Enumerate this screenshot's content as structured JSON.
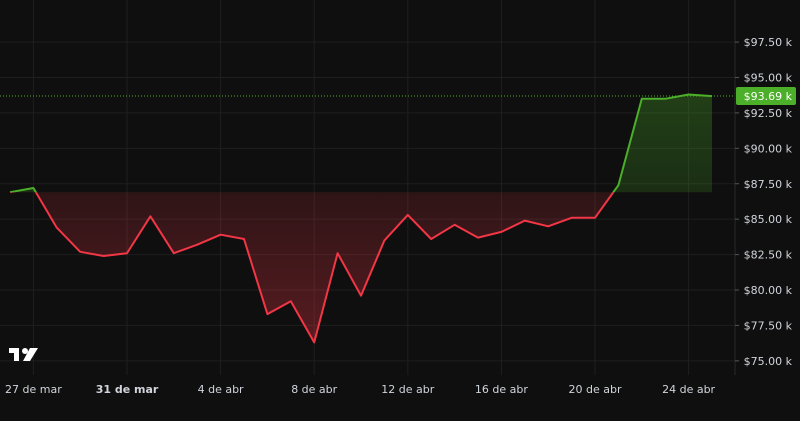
{
  "chart_data": {
    "type": "area",
    "colors": {
      "background": "#0f0f0f",
      "grid": "#1f1f1f",
      "rising": "#4caf2a",
      "falling": "#f23645",
      "price_badge": "#4caf2a",
      "text": "#d1d4dc"
    },
    "baseline": 86.9,
    "ylim": [
      74.0,
      99.2
    ],
    "y_ticks": [
      {
        "value": 75.0,
        "label": "$75.00 k"
      },
      {
        "value": 77.5,
        "label": "$77.50 k"
      },
      {
        "value": 80.0,
        "label": "$80.00 k"
      },
      {
        "value": 82.5,
        "label": "$82.50 k"
      },
      {
        "value": 85.0,
        "label": "$85.00 k"
      },
      {
        "value": 87.5,
        "label": "$87.50 k"
      },
      {
        "value": 90.0,
        "label": "$90.00 k"
      },
      {
        "value": 92.5,
        "label": "$92.50 k"
      },
      {
        "value": 95.0,
        "label": "$95.00 k"
      },
      {
        "value": 97.5,
        "label": "$97.50 k"
      }
    ],
    "x_range": [
      "2025-03-26",
      "2025-04-26"
    ],
    "x_ticks": [
      {
        "date": "2025-03-27",
        "label": "27 de mar",
        "bold": false
      },
      {
        "date": "2025-03-31",
        "label": "31 de mar",
        "bold": true
      },
      {
        "date": "2025-04-04",
        "label": "4 de abr",
        "bold": false
      },
      {
        "date": "2025-04-08",
        "label": "8 de abr",
        "bold": false
      },
      {
        "date": "2025-04-12",
        "label": "12 de abr",
        "bold": false
      },
      {
        "date": "2025-04-16",
        "label": "16 de abr",
        "bold": false
      },
      {
        "date": "2025-04-20",
        "label": "20 de abr",
        "bold": false
      },
      {
        "date": "2025-04-24",
        "label": "24 de abr",
        "bold": false
      }
    ],
    "series": [
      {
        "points": [
          {
            "x": "2025-03-26",
            "y": 86.9
          },
          {
            "x": "2025-03-27",
            "y": 87.2
          },
          {
            "x": "2025-03-28",
            "y": 84.4
          },
          {
            "x": "2025-03-29",
            "y": 82.7
          },
          {
            "x": "2025-03-30",
            "y": 82.4
          },
          {
            "x": "2025-03-31",
            "y": 82.6
          },
          {
            "x": "2025-04-01",
            "y": 85.2
          },
          {
            "x": "2025-04-02",
            "y": 82.6
          },
          {
            "x": "2025-04-03",
            "y": 83.2
          },
          {
            "x": "2025-04-04",
            "y": 83.9
          },
          {
            "x": "2025-04-05",
            "y": 83.6
          },
          {
            "x": "2025-04-06",
            "y": 78.3
          },
          {
            "x": "2025-04-07",
            "y": 79.2
          },
          {
            "x": "2025-04-08",
            "y": 76.3
          },
          {
            "x": "2025-04-09",
            "y": 82.6
          },
          {
            "x": "2025-04-10",
            "y": 79.6
          },
          {
            "x": "2025-04-11",
            "y": 83.5
          },
          {
            "x": "2025-04-12",
            "y": 85.3
          },
          {
            "x": "2025-04-13",
            "y": 83.6
          },
          {
            "x": "2025-04-14",
            "y": 84.6
          },
          {
            "x": "2025-04-15",
            "y": 83.7
          },
          {
            "x": "2025-04-16",
            "y": 84.1
          },
          {
            "x": "2025-04-17",
            "y": 84.9
          },
          {
            "x": "2025-04-18",
            "y": 84.5
          },
          {
            "x": "2025-04-19",
            "y": 85.1
          },
          {
            "x": "2025-04-20",
            "y": 85.1
          },
          {
            "x": "2025-04-21",
            "y": 87.4
          },
          {
            "x": "2025-04-22",
            "y": 93.5
          },
          {
            "x": "2025-04-23",
            "y": 93.5
          },
          {
            "x": "2025-04-24",
            "y": 93.8
          },
          {
            "x": "2025-04-25",
            "y": 93.69
          }
        ]
      }
    ],
    "current_price": {
      "value": 93.69,
      "label": "$93.69 k"
    },
    "grid": true
  },
  "branding": {
    "logo_icon": "tradingview-logo-icon"
  }
}
